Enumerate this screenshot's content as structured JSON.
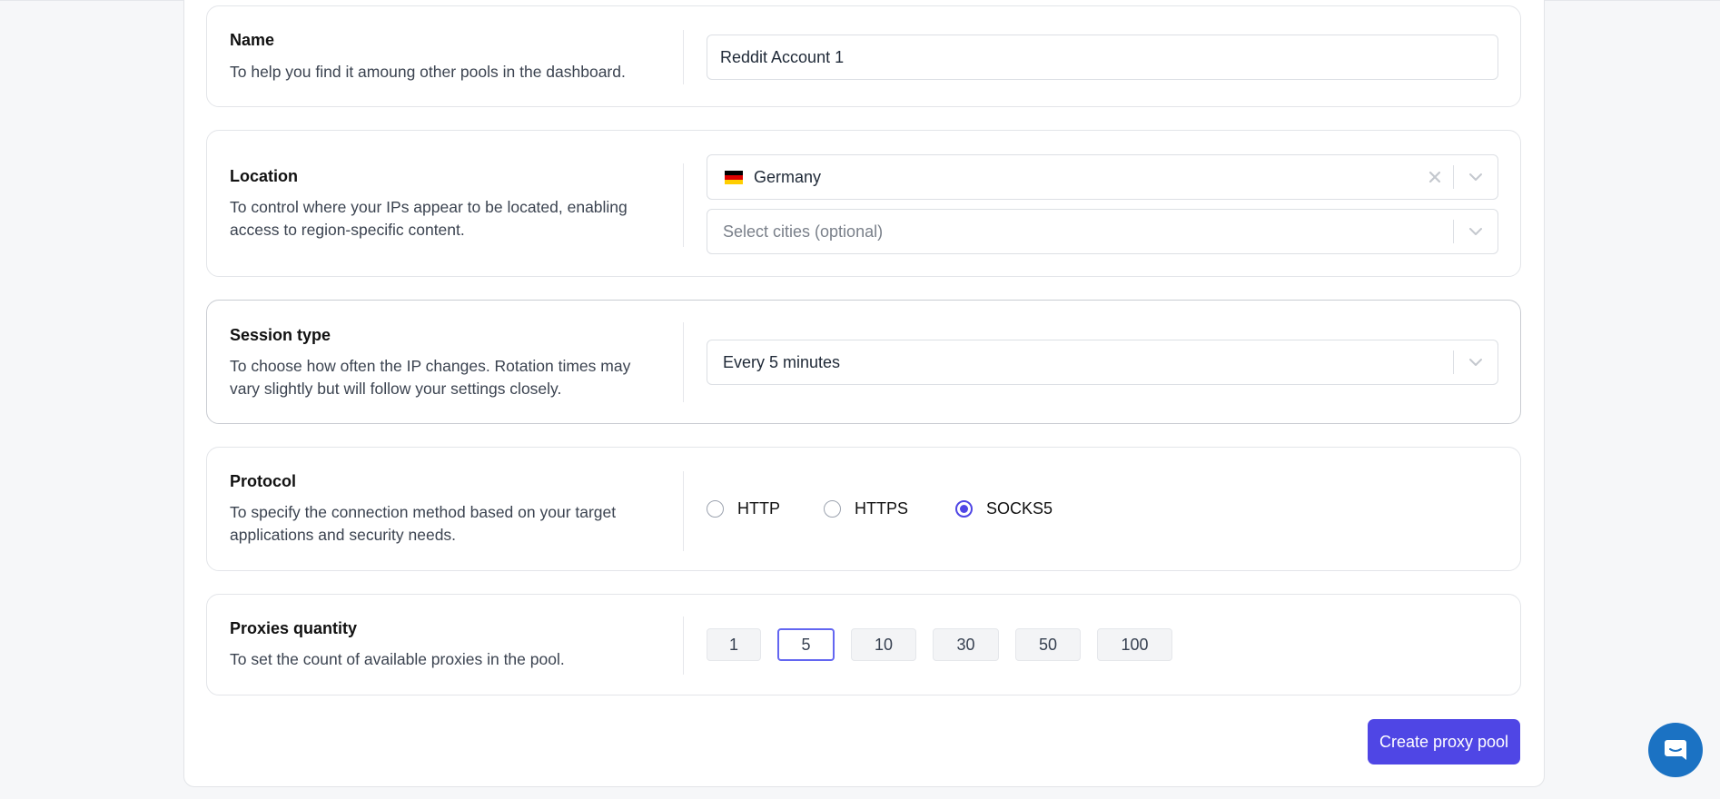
{
  "name_section": {
    "label": "Name",
    "description": "To help you find it amoung other pools in the dashboard.",
    "value": "Reddit Account 1"
  },
  "location_section": {
    "label": "Location",
    "description": "To control where your IPs appear to be located, enabling access to region-specific content.",
    "country": {
      "value": "Germany",
      "flag_colors": [
        "#000000",
        "#dd0000",
        "#ffce00"
      ]
    },
    "cities": {
      "placeholder": "Select cities (optional)"
    }
  },
  "session_section": {
    "label": "Session type",
    "description": "To choose how often the IP changes. Rotation times may vary slightly but will follow your settings closely.",
    "value": "Every 5 minutes"
  },
  "protocol_section": {
    "label": "Protocol",
    "description": "To specify the connection method based on your target applications and security needs.",
    "options": [
      "HTTP",
      "HTTPS",
      "SOCKS5"
    ],
    "selected": "SOCKS5"
  },
  "quantity_section": {
    "label": "Proxies quantity",
    "description": "To set the count of available proxies in the pool.",
    "options": [
      "1",
      "5",
      "10",
      "30",
      "50",
      "100"
    ],
    "selected": "5"
  },
  "actions": {
    "create_label": "Create proxy pool"
  },
  "colors": {
    "accent": "#4f46e5",
    "chat": "#1b72c3"
  },
  "icons": [
    "close-icon",
    "chevron-down-icon",
    "chat-icon"
  ]
}
